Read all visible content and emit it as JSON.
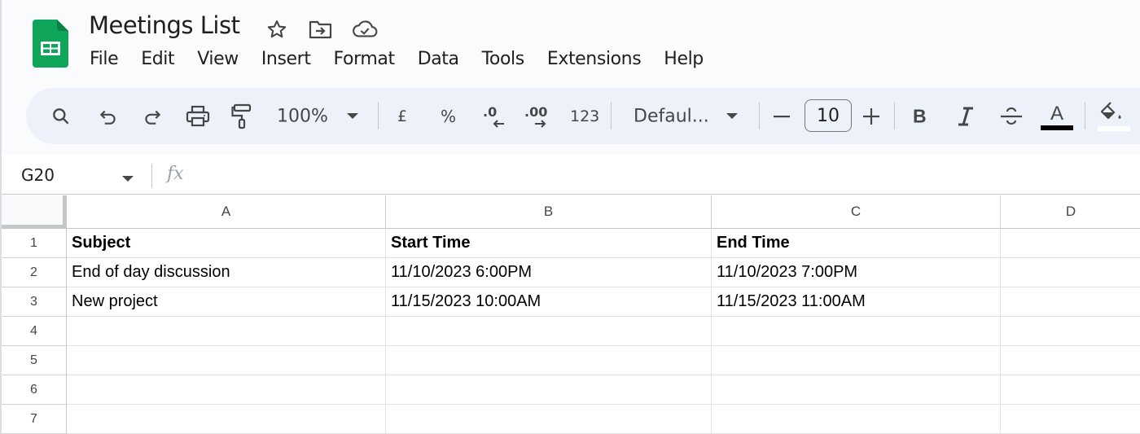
{
  "app": {
    "title": "Meetings List",
    "brand_color": "#0f9d58"
  },
  "menu": [
    "File",
    "Edit",
    "View",
    "Insert",
    "Format",
    "Data",
    "Tools",
    "Extensions",
    "Help"
  ],
  "toolbar": {
    "zoom": "100%",
    "currency": "£",
    "percent": "%",
    "decrease_decimal": ".0",
    "increase_decimal": ".00",
    "number_format": "123",
    "font": "Defaul...",
    "font_size": "10",
    "bold": "B",
    "italic": "I",
    "text_color_letter": "A",
    "text_color": "#000000",
    "fill_color": "#ffffff"
  },
  "formula_bar": {
    "cell_ref": "G20",
    "fx": "fx",
    "value": ""
  },
  "sheet": {
    "columns": [
      "A",
      "B",
      "C",
      "D"
    ],
    "rows": [
      "1",
      "2",
      "3",
      "4",
      "5",
      "6",
      "7"
    ],
    "cells": [
      [
        "Subject",
        "Start Time",
        "End Time",
        ""
      ],
      [
        "End of day discussion",
        "11/10/2023 6:00PM",
        "11/10/2023 7:00PM",
        ""
      ],
      [
        "New project",
        "11/15/2023 10:00AM",
        "11/15/2023 11:00AM",
        ""
      ],
      [
        "",
        "",
        "",
        ""
      ],
      [
        "",
        "",
        "",
        ""
      ],
      [
        "",
        "",
        "",
        ""
      ],
      [
        "",
        "",
        "",
        ""
      ]
    ]
  }
}
